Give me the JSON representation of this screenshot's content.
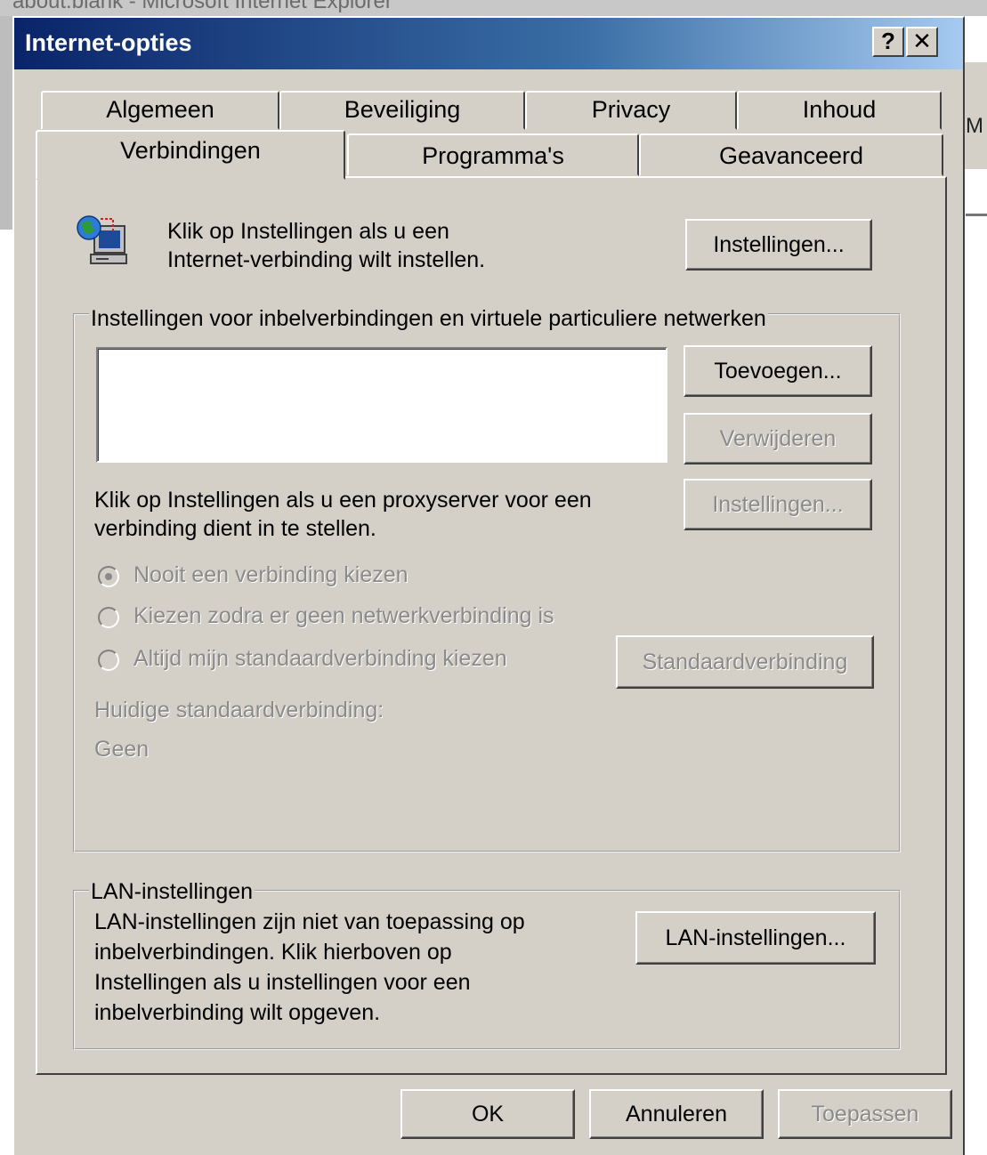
{
  "background": {
    "window_title": "about:blank - Microsoft Internet Explorer",
    "edge_letter": "M"
  },
  "dialog": {
    "title": "Internet-opties",
    "help_button": "?",
    "close_button": "✕"
  },
  "tabs": {
    "back_row": [
      "Algemeen",
      "Beveiliging",
      "Privacy",
      "Inhoud"
    ],
    "front_row": [
      "Verbindingen",
      "Programma's",
      "Geavanceerd"
    ],
    "active": "Verbindingen"
  },
  "setup": {
    "text_line1": "Klik op Instellingen als u een",
    "text_line2": "Internet-verbinding wilt instellen.",
    "button": "Instellingen..."
  },
  "dialup": {
    "legend": "Instellingen voor inbelverbindingen en virtuele particuliere netwerken",
    "add_button": "Toevoegen...",
    "remove_button": "Verwijderen",
    "proxy_text_line1": "Klik op Instellingen als u een proxyserver voor een",
    "proxy_text_line2": "verbinding dient in te stellen.",
    "settings_button": "Instellingen...",
    "radio_options": [
      "Nooit een verbinding kiezen",
      "Kiezen zodra er geen netwerkverbinding is",
      "Altijd mijn standaardverbinding kiezen"
    ],
    "selected_option": 0,
    "default_button": "Standaardverbinding",
    "current_label": "Huidige standaardverbinding:",
    "current_value": "Geen"
  },
  "lan": {
    "legend": "LAN-instellingen",
    "text_lines": [
      "LAN-instellingen zijn niet van toepassing op",
      "inbelverbindingen. Klik hierboven op",
      "Instellingen als u instellingen voor een",
      "inbelverbinding wilt opgeven."
    ],
    "button": "LAN-instellingen..."
  },
  "footer": {
    "ok": "OK",
    "cancel": "Annuleren",
    "apply": "Toepassen"
  }
}
